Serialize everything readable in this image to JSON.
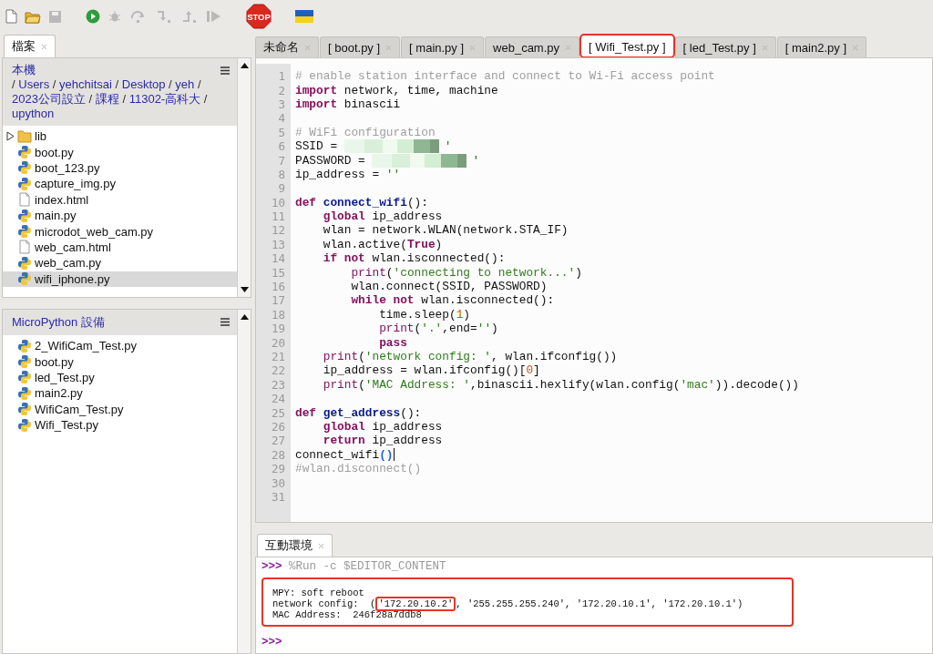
{
  "toolbar": [
    {
      "kind": "new",
      "disabled": false
    },
    {
      "kind": "open",
      "disabled": false
    },
    {
      "kind": "save",
      "disabled": true
    },
    {
      "kind": "run",
      "disabled": false
    },
    {
      "kind": "debug",
      "disabled": true
    },
    {
      "kind": "step-over",
      "disabled": true
    },
    {
      "kind": "step-into",
      "disabled": true
    },
    {
      "kind": "step-out",
      "disabled": true
    },
    {
      "kind": "resume",
      "disabled": true
    },
    {
      "kind": "stop",
      "disabled": false,
      "label": "STOP"
    },
    {
      "kind": "flag",
      "disabled": false
    }
  ],
  "files_tab": {
    "label": "檔案",
    "selected": true
  },
  "local_panel": {
    "title": "本機",
    "path_separator": "/",
    "path": [
      "Users",
      "yehchitsai",
      "Desktop",
      "yeh",
      "2023公司設立",
      "課程",
      "11302-高科大",
      "upython"
    ],
    "items": [
      {
        "name": "lib",
        "kind": "folder",
        "expanded": false,
        "selected": false
      },
      {
        "name": "boot.py",
        "kind": "python",
        "selected": false
      },
      {
        "name": "boot_123.py",
        "kind": "python",
        "selected": false
      },
      {
        "name": "capture_img.py",
        "kind": "python",
        "selected": false
      },
      {
        "name": "index.html",
        "kind": "file",
        "selected": false
      },
      {
        "name": "main.py",
        "kind": "python",
        "selected": false
      },
      {
        "name": "microdot_web_cam.py",
        "kind": "python",
        "selected": false
      },
      {
        "name": "web_cam.html",
        "kind": "file",
        "selected": false
      },
      {
        "name": "web_cam.py",
        "kind": "python",
        "selected": false
      },
      {
        "name": "wifi_iphone.py",
        "kind": "python",
        "selected": true
      }
    ]
  },
  "device_panel": {
    "title": "MicroPython 設備",
    "items": [
      {
        "name": "2_WifiCam_Test.py",
        "kind": "python",
        "selected": false
      },
      {
        "name": "boot.py",
        "kind": "python",
        "selected": false
      },
      {
        "name": "led_Test.py",
        "kind": "python",
        "selected": false
      },
      {
        "name": "main2.py",
        "kind": "python",
        "selected": false
      },
      {
        "name": "WifiCam_Test.py",
        "kind": "python",
        "selected": false
      },
      {
        "name": "Wifi_Test.py",
        "kind": "python",
        "selected": false
      }
    ]
  },
  "editor_tabs": [
    {
      "label": "未命名",
      "selected": false,
      "highlighted": false
    },
    {
      "label": "[ boot.py ]",
      "selected": false,
      "highlighted": false
    },
    {
      "label": "[ main.py ]",
      "selected": false,
      "highlighted": false
    },
    {
      "label": "web_cam.py",
      "selected": false,
      "highlighted": false
    },
    {
      "label": "[ Wifi_Test.py ]",
      "selected": true,
      "highlighted": true
    },
    {
      "label": "[ led_Test.py ]",
      "selected": false,
      "highlighted": false
    },
    {
      "label": "[ main2.py ]",
      "selected": false,
      "highlighted": false
    }
  ],
  "code_lines": [
    {
      "number": "1",
      "tokens": [
        {
          "kind": "comment",
          "text": "# enable station interface and connect to Wi-Fi access point"
        }
      ]
    },
    {
      "number": "2",
      "tokens": [
        {
          "kind": "keyword",
          "text": "import"
        },
        {
          "kind": "plain",
          "text": " network, time, machine"
        }
      ]
    },
    {
      "number": "3",
      "tokens": [
        {
          "kind": "keyword",
          "text": "import"
        },
        {
          "kind": "plain",
          "text": " binascii"
        }
      ]
    },
    {
      "number": "4"
    },
    {
      "number": "5",
      "tokens": [
        {
          "kind": "comment",
          "text": "# WiFi configuration"
        }
      ]
    },
    {
      "number": "6",
      "tokens": [
        {
          "kind": "plain",
          "text": "SSID = "
        },
        {
          "kind": "redacted"
        },
        {
          "kind": "string",
          "text": "'"
        }
      ]
    },
    {
      "number": "7",
      "tokens": [
        {
          "kind": "plain",
          "text": "PASSWORD = "
        },
        {
          "kind": "redacted"
        },
        {
          "kind": "string",
          "text": "'"
        }
      ]
    },
    {
      "number": "8",
      "tokens": [
        {
          "kind": "plain",
          "text": "ip_address = "
        },
        {
          "kind": "string",
          "text": "''"
        }
      ]
    },
    {
      "number": "9"
    },
    {
      "number": "10",
      "tokens": [
        {
          "kind": "keyword",
          "text": "def "
        },
        {
          "kind": "function",
          "text": "connect_wifi"
        },
        {
          "kind": "plain",
          "text": "():"
        }
      ]
    },
    {
      "number": "11",
      "tokens": [
        {
          "kind": "keyword",
          "text": "    global"
        },
        {
          "kind": "plain",
          "text": " ip_address"
        }
      ]
    },
    {
      "number": "12",
      "tokens": [
        {
          "kind": "plain",
          "text": "    wlan = network.WLAN(network.STA_IF)"
        }
      ]
    },
    {
      "number": "13",
      "tokens": [
        {
          "kind": "plain",
          "text": "    wlan.active("
        },
        {
          "kind": "keyword",
          "text": "True"
        },
        {
          "kind": "plain",
          "text": ")"
        }
      ]
    },
    {
      "number": "14",
      "tokens": [
        {
          "kind": "keyword",
          "text": "    if not"
        },
        {
          "kind": "plain",
          "text": " wlan.isconnected():"
        }
      ]
    },
    {
      "number": "15",
      "tokens": [
        {
          "kind": "builtin",
          "text": "        print"
        },
        {
          "kind": "plain",
          "text": "("
        },
        {
          "kind": "string",
          "text": "'connecting to network...'"
        },
        {
          "kind": "plain",
          "text": ")"
        }
      ]
    },
    {
      "number": "16",
      "tokens": [
        {
          "kind": "plain",
          "text": "        wlan.connect(SSID, PASSWORD)"
        }
      ]
    },
    {
      "number": "17",
      "tokens": [
        {
          "kind": "keyword",
          "text": "        while not"
        },
        {
          "kind": "plain",
          "text": " wlan.isconnected():"
        }
      ]
    },
    {
      "number": "18",
      "tokens": [
        {
          "kind": "plain",
          "text": "            time.sleep("
        },
        {
          "kind": "number",
          "text": "1"
        },
        {
          "kind": "plain",
          "text": ")"
        }
      ]
    },
    {
      "number": "19",
      "tokens": [
        {
          "kind": "builtin",
          "text": "            print"
        },
        {
          "kind": "plain",
          "text": "("
        },
        {
          "kind": "string",
          "text": "'.'"
        },
        {
          "kind": "plain",
          "text": ",end="
        },
        {
          "kind": "string",
          "text": "''"
        },
        {
          "kind": "plain",
          "text": ")"
        }
      ]
    },
    {
      "number": "20",
      "tokens": [
        {
          "kind": "keyword",
          "text": "            pass"
        }
      ]
    },
    {
      "number": "21",
      "tokens": [
        {
          "kind": "builtin",
          "text": "    print"
        },
        {
          "kind": "plain",
          "text": "("
        },
        {
          "kind": "string",
          "text": "'network config: '"
        },
        {
          "kind": "plain",
          "text": ", wlan.ifconfig())"
        }
      ]
    },
    {
      "number": "22",
      "tokens": [
        {
          "kind": "plain",
          "text": "    ip_address = wlan.ifconfig()["
        },
        {
          "kind": "number",
          "text": "0"
        },
        {
          "kind": "plain",
          "text": "]"
        }
      ]
    },
    {
      "number": "23",
      "tokens": [
        {
          "kind": "builtin",
          "text": "    print"
        },
        {
          "kind": "plain",
          "text": "("
        },
        {
          "kind": "string",
          "text": "'MAC Address: '"
        },
        {
          "kind": "plain",
          "text": ",binascii.hexlify(wlan.config("
        },
        {
          "kind": "string",
          "text": "'mac'"
        },
        {
          "kind": "plain",
          "text": ")).decode())"
        }
      ]
    },
    {
      "number": "24"
    },
    {
      "number": "25",
      "tokens": [
        {
          "kind": "keyword",
          "text": "def "
        },
        {
          "kind": "function",
          "text": "get_address"
        },
        {
          "kind": "plain",
          "text": "():"
        }
      ]
    },
    {
      "number": "26",
      "tokens": [
        {
          "kind": "keyword",
          "text": "    global"
        },
        {
          "kind": "plain",
          "text": " ip_address"
        }
      ]
    },
    {
      "number": "27",
      "tokens": [
        {
          "kind": "keyword",
          "text": "    return"
        },
        {
          "kind": "plain",
          "text": " ip_address"
        }
      ]
    },
    {
      "number": "28",
      "cursor": true,
      "tokens": [
        {
          "kind": "plain",
          "text": "connect_wifi"
        },
        {
          "kind": "bracket",
          "text": "()"
        }
      ]
    },
    {
      "number": "29",
      "tokens": [
        {
          "kind": "comment",
          "text": "#wlan.disconnect()"
        }
      ]
    },
    {
      "number": "30"
    },
    {
      "number": "31"
    }
  ],
  "shell_tab": {
    "label": "互動環境",
    "selected": true
  },
  "shell": {
    "prompt": ">>>",
    "command": "%Run -c $EDITOR_CONTENT",
    "output": {
      "highlighted": true,
      "lines": [
        {
          "segments": [
            {
              "text": "MPY: soft reboot",
              "highlighted": false
            }
          ]
        },
        {
          "segments": [
            {
              "text": "network config:  (",
              "highlighted": false
            },
            {
              "text": "'172.20.10.2'",
              "highlighted": true
            },
            {
              "text": ", '255.255.255.240', '172.20.10.1', '172.20.10.1')",
              "highlighted": false
            }
          ]
        },
        {
          "segments": [
            {
              "text": "MAC Address:  246f28a7ddb8",
              "highlighted": false
            }
          ]
        }
      ]
    },
    "final_prompt": ">>>"
  }
}
